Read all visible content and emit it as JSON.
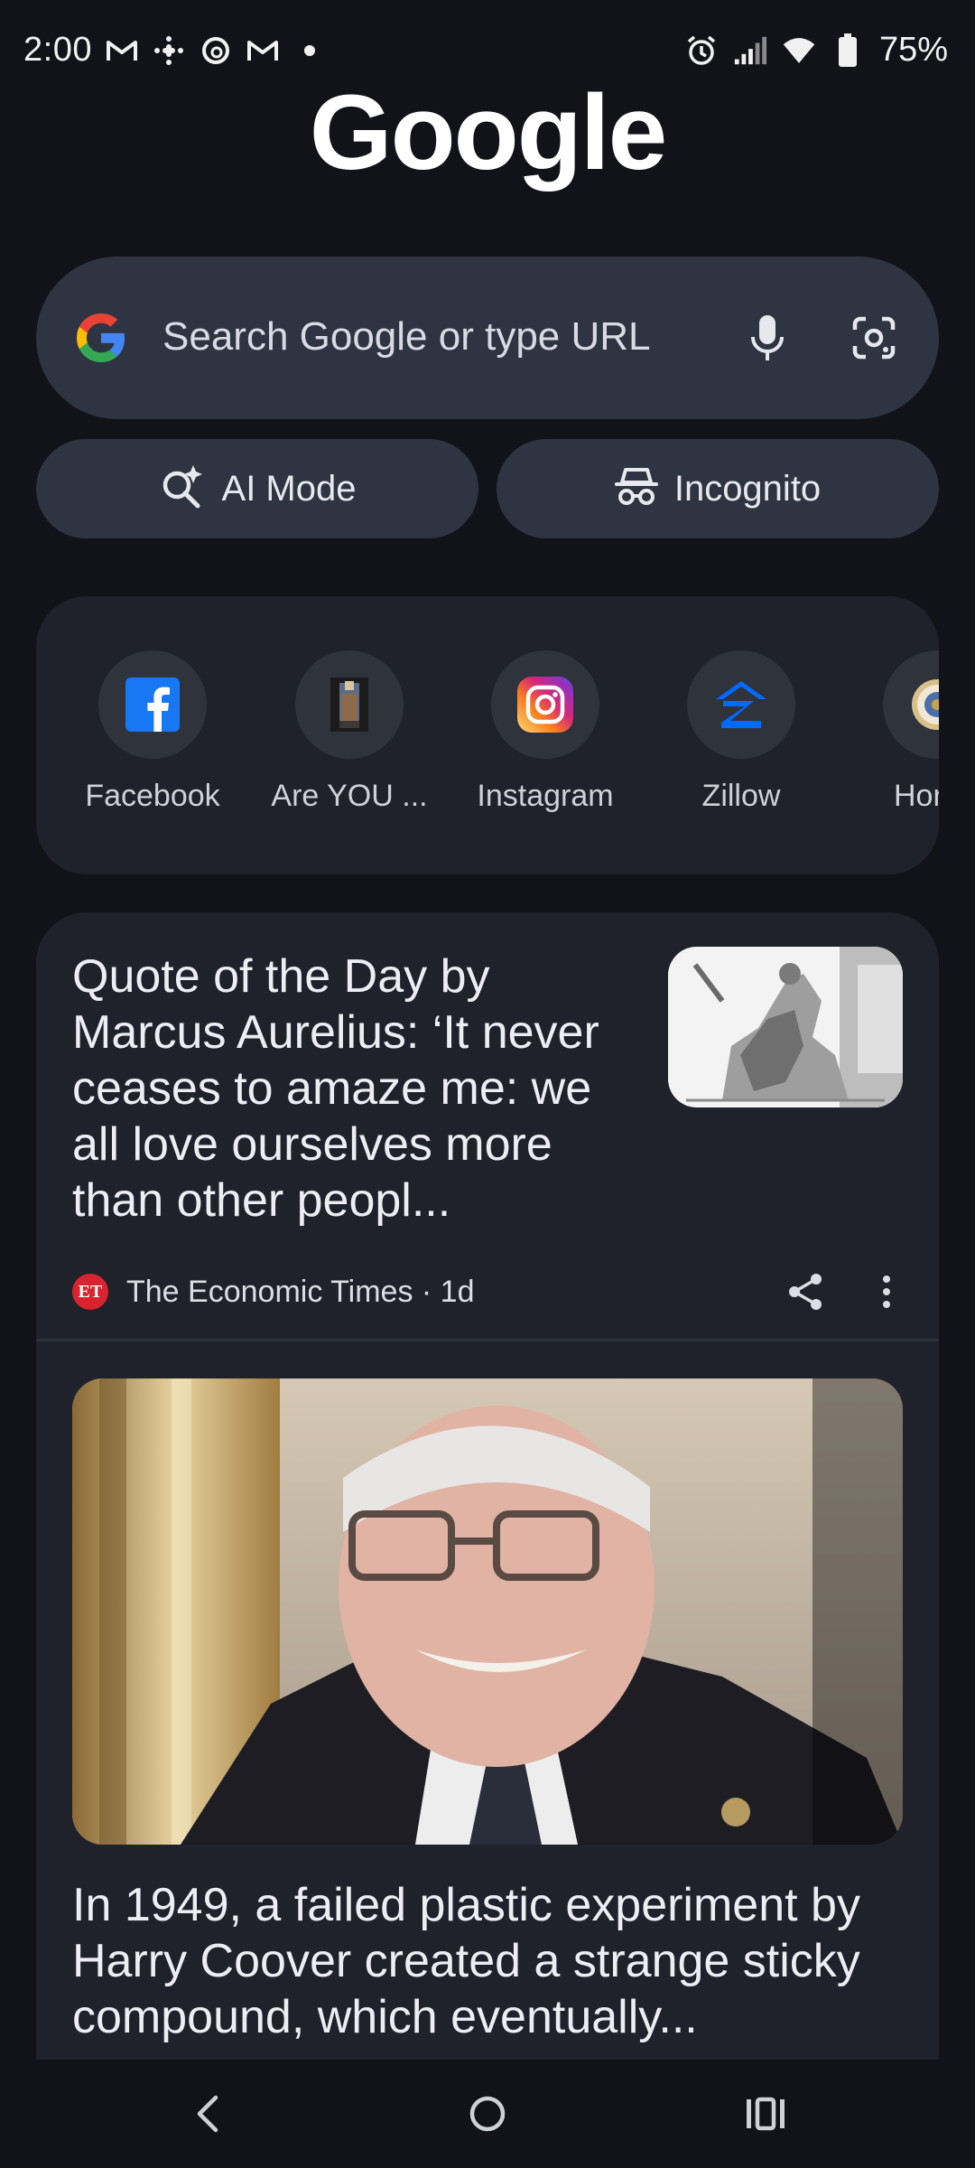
{
  "status_bar": {
    "time": "2:00",
    "battery": "75%",
    "left_icons": [
      "gmail-icon",
      "slack-icon",
      "threads-icon",
      "gmail-icon",
      "dot-icon"
    ],
    "right_icons": [
      "alarm-icon",
      "signal-icon",
      "wifi-icon",
      "battery-icon"
    ]
  },
  "logo": {
    "text": "Google"
  },
  "search": {
    "placeholder": "Search Google or type URL"
  },
  "pills": {
    "ai_mode": "AI Mode",
    "incognito": "Incognito"
  },
  "shortcuts": [
    {
      "label": "Facebook",
      "icon": "facebook-icon"
    },
    {
      "label": "Are YOU ...",
      "icon": "site-thumbnail-icon"
    },
    {
      "label": "Instagram",
      "icon": "instagram-icon"
    },
    {
      "label": "Zillow",
      "icon": "zillow-icon"
    },
    {
      "label": "Hor",
      "icon": "seal-icon"
    }
  ],
  "feed": [
    {
      "title": "Quote of the Day by Marcus Aurelius: ‘It never ceases to amaze me: we all love ourselves more than other peopl...",
      "source": "The Economic Times · 1d",
      "source_logo": "ET"
    },
    {
      "title": "In 1949, a failed plastic experiment by Harry Coover created a strange sticky compound, which eventually..."
    }
  ],
  "colors": {
    "background": "#111318",
    "surface": "#2f3442",
    "card": "#1f222a",
    "et_red": "#d9232e"
  }
}
